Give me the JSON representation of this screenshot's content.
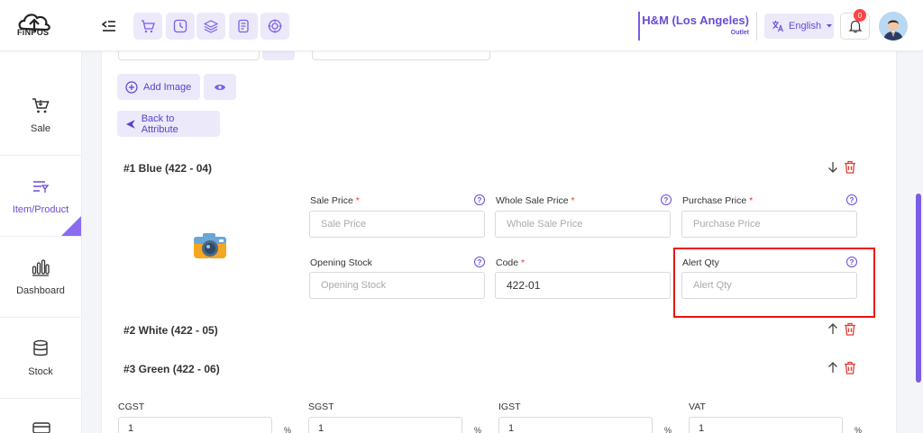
{
  "header": {
    "logo_text": "FiNPOS",
    "outlet_name": "H&M (Los Angeles)",
    "outlet_sub": "Outlet",
    "language": "English",
    "notification_count": "0",
    "quick_icons": [
      "cart-icon",
      "clock-icon",
      "layers-icon",
      "receipt-icon",
      "target-icon"
    ]
  },
  "sidebar": {
    "items": [
      {
        "label": "Sale",
        "icon": "cart-icon"
      },
      {
        "label": "Item/Product",
        "icon": "list-filter-icon",
        "active": true
      },
      {
        "label": "Dashboard",
        "icon": "bar-chart-icon"
      },
      {
        "label": "Stock",
        "icon": "database-icon"
      }
    ]
  },
  "main": {
    "add_image": "Add Image",
    "back_to_attribute": "Back to Attribute",
    "variants": [
      {
        "title": "#1 Blue (422 - 04)"
      },
      {
        "title": "#2 White (422 - 05)"
      },
      {
        "title": "#3 Green (422 - 06)"
      }
    ],
    "fields": {
      "sale_price": {
        "label": "Sale Price",
        "required": "*",
        "placeholder": "Sale Price"
      },
      "whole_sale_price": {
        "label": "Whole Sale Price",
        "required": "*",
        "placeholder": "Whole Sale Price"
      },
      "purchase_price": {
        "label": "Purchase Price",
        "required": "*",
        "placeholder": "Purchase Price"
      },
      "opening_stock": {
        "label": "Opening Stock",
        "placeholder": "Opening Stock"
      },
      "code": {
        "label": "Code",
        "required": "*",
        "value": "422-01"
      },
      "alert_qty": {
        "label": "Alert Qty",
        "placeholder": "Alert Qty"
      }
    },
    "taxes": [
      {
        "label": "CGST",
        "value": "1",
        "unit": "%"
      },
      {
        "label": "SGST",
        "value": "1",
        "unit": "%"
      },
      {
        "label": "IGST",
        "value": "1",
        "unit": "%"
      },
      {
        "label": "VAT",
        "value": "1",
        "unit": "%"
      }
    ],
    "help_glyph": "?"
  },
  "colors": {
    "accent": "#6a4ad8",
    "accent_light": "#ece9fb",
    "danger": "#e53935",
    "highlight": "#ee1111"
  }
}
